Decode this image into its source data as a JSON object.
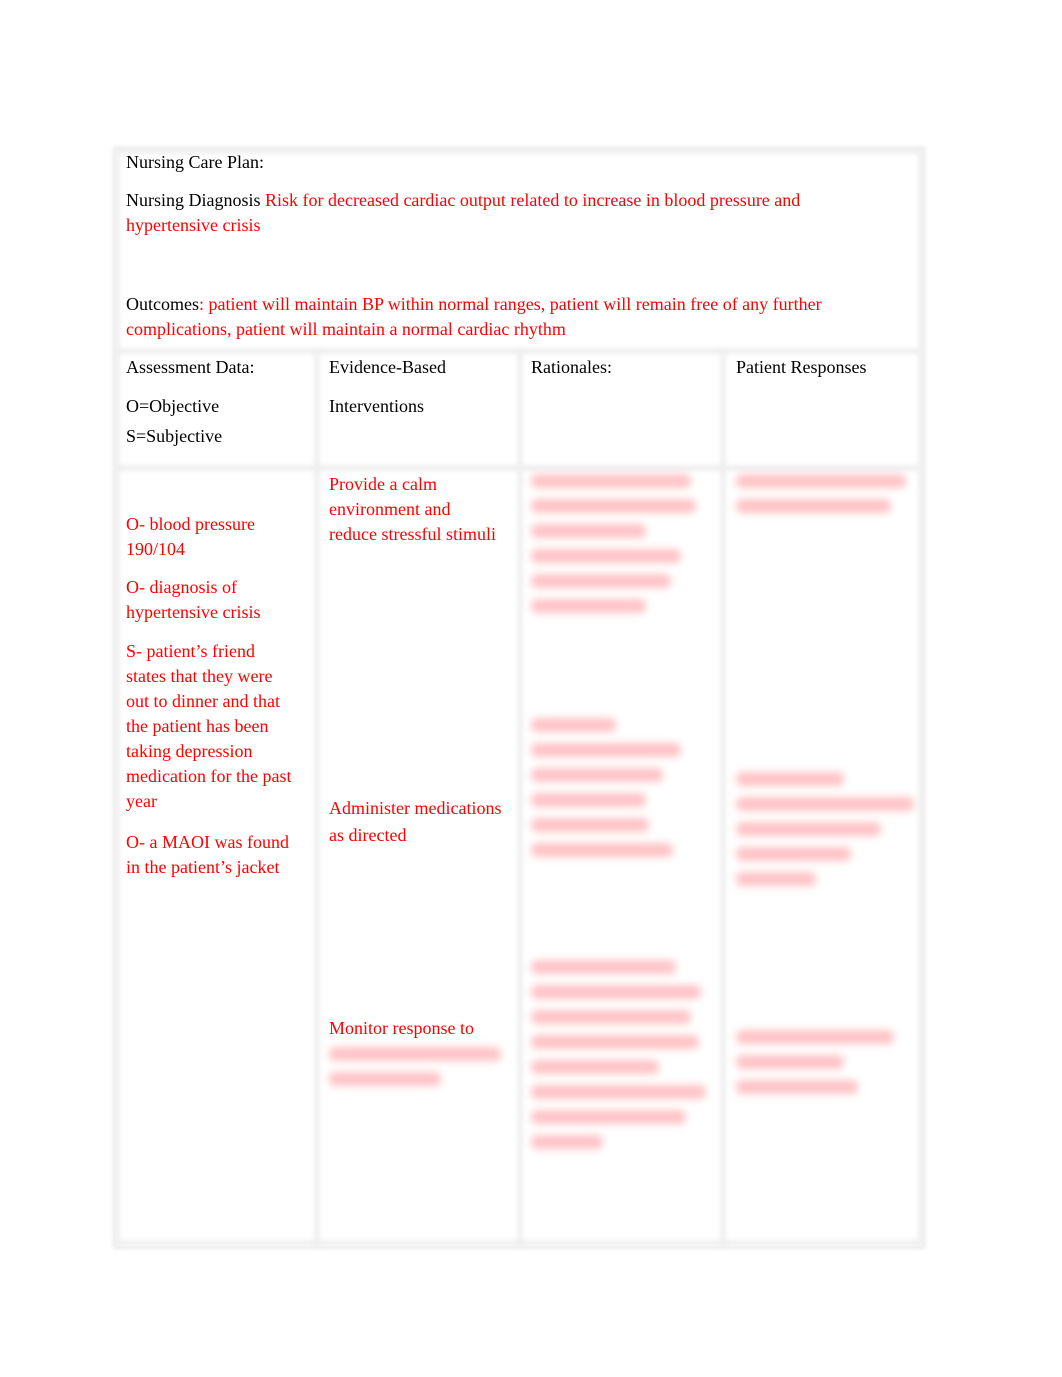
{
  "document": {
    "title": "Nursing Care Plan:",
    "diagnosis_label": "Nursing Diagnosis",
    "diagnosis_text": "Risk for decreased cardiac output related to increase in blood pressure and",
    "diagnosis_text_2": "hypertensive crisis",
    "outcomes_label": "Outcomes",
    "outcomes_text": ": patient will maintain BP within normal ranges, patient will remain free of any further",
    "outcomes_text_2": "complications, patient will maintain a normal cardiac rhythm",
    "colors": {
      "answer_text": "#ff0000",
      "label_text": "#000000",
      "border": "#efefef"
    }
  },
  "table": {
    "headers": {
      "assessment": [
        "Assessment Data:",
        "O=Objective",
        "S=Subjective"
      ],
      "interventions": [
        "Evidence-Based",
        "Interventions"
      ],
      "rationales": [
        "Rationales:"
      ],
      "responses": [
        "Patient Responses"
      ]
    },
    "assessment": [
      [
        "O- blood pressure",
        "190/104"
      ],
      [
        "O- diagnosis of",
        "hypertensive crisis"
      ],
      [
        "S- patient’s friend",
        "states that they were",
        "out to dinner and that",
        "the patient has been",
        "taking depression",
        "medication for the past",
        "year"
      ],
      [
        "O- a MAOI was found",
        "in the patient’s jacket"
      ]
    ],
    "interventions": [
      [
        "Provide a calm",
        "environment and",
        "reduce stressful stimuli"
      ],
      [
        "Administer medications",
        "as directed"
      ],
      [
        "Monitor response to",
        "[blurred]",
        "[blurred]"
      ]
    ],
    "rationales": [
      "[blurred]",
      "[blurred]",
      "[blurred]"
    ],
    "responses": [
      "[blurred]",
      "[blurred]",
      "[blurred]"
    ]
  }
}
